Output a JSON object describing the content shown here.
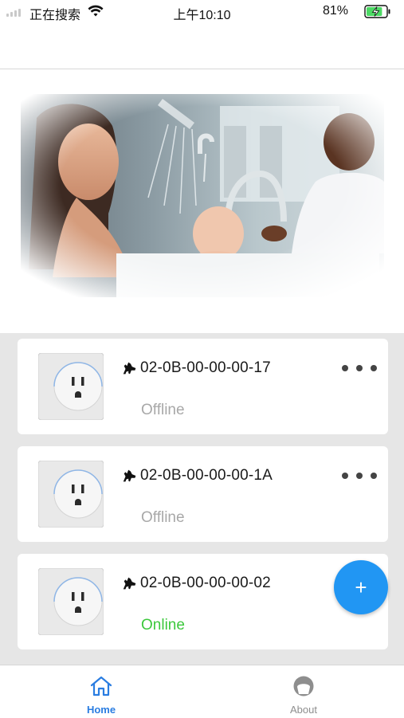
{
  "status_bar": {
    "carrier": "正在搜索",
    "time": "上午10:10",
    "battery_percent": "81%",
    "battery_level": 0.81,
    "icons": [
      "signal-icon",
      "wifi-icon",
      "battery-charging-icon"
    ]
  },
  "banner": {
    "description_icon": "water-banner-image"
  },
  "devices": [
    {
      "name": "02-0B-00-00-00-17",
      "status": "Offline",
      "status_color": "#a8a8a8",
      "has_more": true
    },
    {
      "name": "02-0B-00-00-00-1A",
      "status": "Offline",
      "status_color": "#a8a8a8",
      "has_more": true
    },
    {
      "name": "02-0B-00-00-00-02",
      "status": "Online",
      "status_color": "#3cc83c",
      "has_more": false
    }
  ],
  "fab": {
    "label": "+",
    "color": "#2196f3"
  },
  "tabs": [
    {
      "label": "Home",
      "icon": "home-icon",
      "active": true,
      "color": "#2a7de1"
    },
    {
      "label": "About",
      "icon": "about-icon",
      "active": false,
      "color": "#8e8e8e"
    }
  ]
}
